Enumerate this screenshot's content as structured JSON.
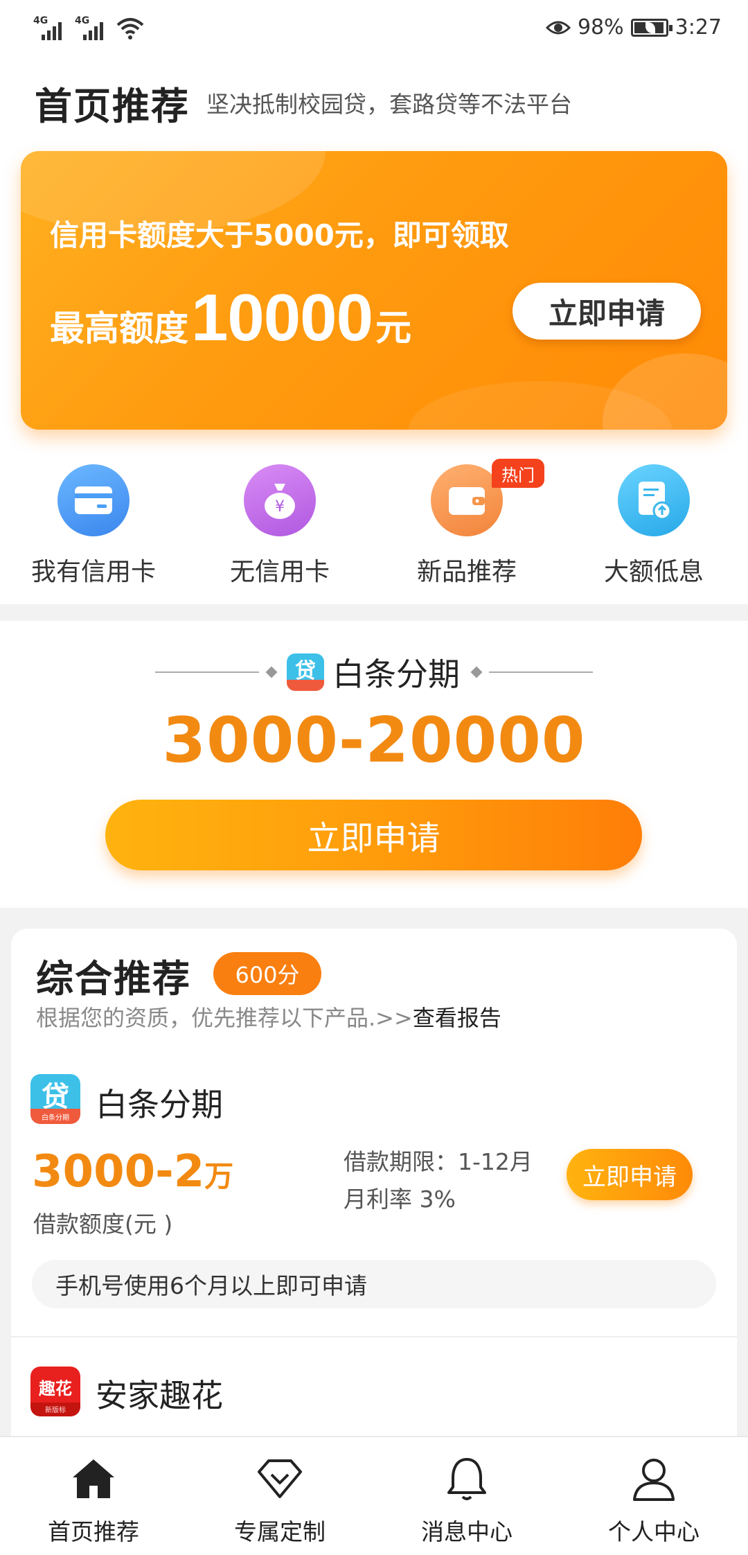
{
  "status_bar": {
    "signal1_label": "4G",
    "signal2_label": "4G",
    "battery_percent": "98%",
    "time": "3:27"
  },
  "header": {
    "title": "首页推荐",
    "subtitle": "坚决抵制校园贷，套路贷等不法平台"
  },
  "banner": {
    "line1": "信用卡额度大于5000元，即可领取",
    "line2_prefix": "最高额度",
    "line2_amount": "10000",
    "line2_unit": "元",
    "cta": "立即申请"
  },
  "quick_nav": [
    {
      "label": "我有信用卡",
      "icon": "credit-card-icon",
      "color": "#4a9ef6"
    },
    {
      "label": "无信用卡",
      "icon": "money-bag-icon",
      "color": "#c069e8"
    },
    {
      "label": "新品推荐",
      "icon": "wallet-icon",
      "color": "#f5954a",
      "badge": "热门"
    },
    {
      "label": "大额低息",
      "icon": "document-upload-icon",
      "color": "#3ab6ec"
    }
  ],
  "featured": {
    "name": "白条分期",
    "logo_text": "贷",
    "amount_range": "3000-20000",
    "cta": "立即申请"
  },
  "recommend": {
    "title": "综合推荐",
    "score_badge": "600分",
    "subtitle": "根据您的资质，优先推荐以下产品.>>",
    "report_link": "查看报告",
    "products": [
      {
        "name": "白条分期",
        "logo_text": "贷",
        "logo_sub": "白条分期",
        "amount": "3000-2",
        "amount_unit": "万",
        "amount_label": "借款额度(元 )",
        "term": "借款期限：1-12月",
        "rate": "月利率 3%",
        "cta": "立即申请",
        "note": "手机号使用6个月以上即可申请"
      },
      {
        "name": "安家趣花",
        "logo_text": "趣花",
        "logo_sub": "新版标"
      }
    ]
  },
  "bottom_nav": [
    {
      "label": "首页推荐",
      "icon": "home-icon",
      "active": true
    },
    {
      "label": "专属定制",
      "icon": "diamond-icon"
    },
    {
      "label": "消息中心",
      "icon": "bell-icon"
    },
    {
      "label": "个人中心",
      "icon": "user-icon"
    }
  ],
  "colors": {
    "accent": "#f28a12",
    "banner_orange": "#ff9c10",
    "badge_red": "#f4421d"
  }
}
